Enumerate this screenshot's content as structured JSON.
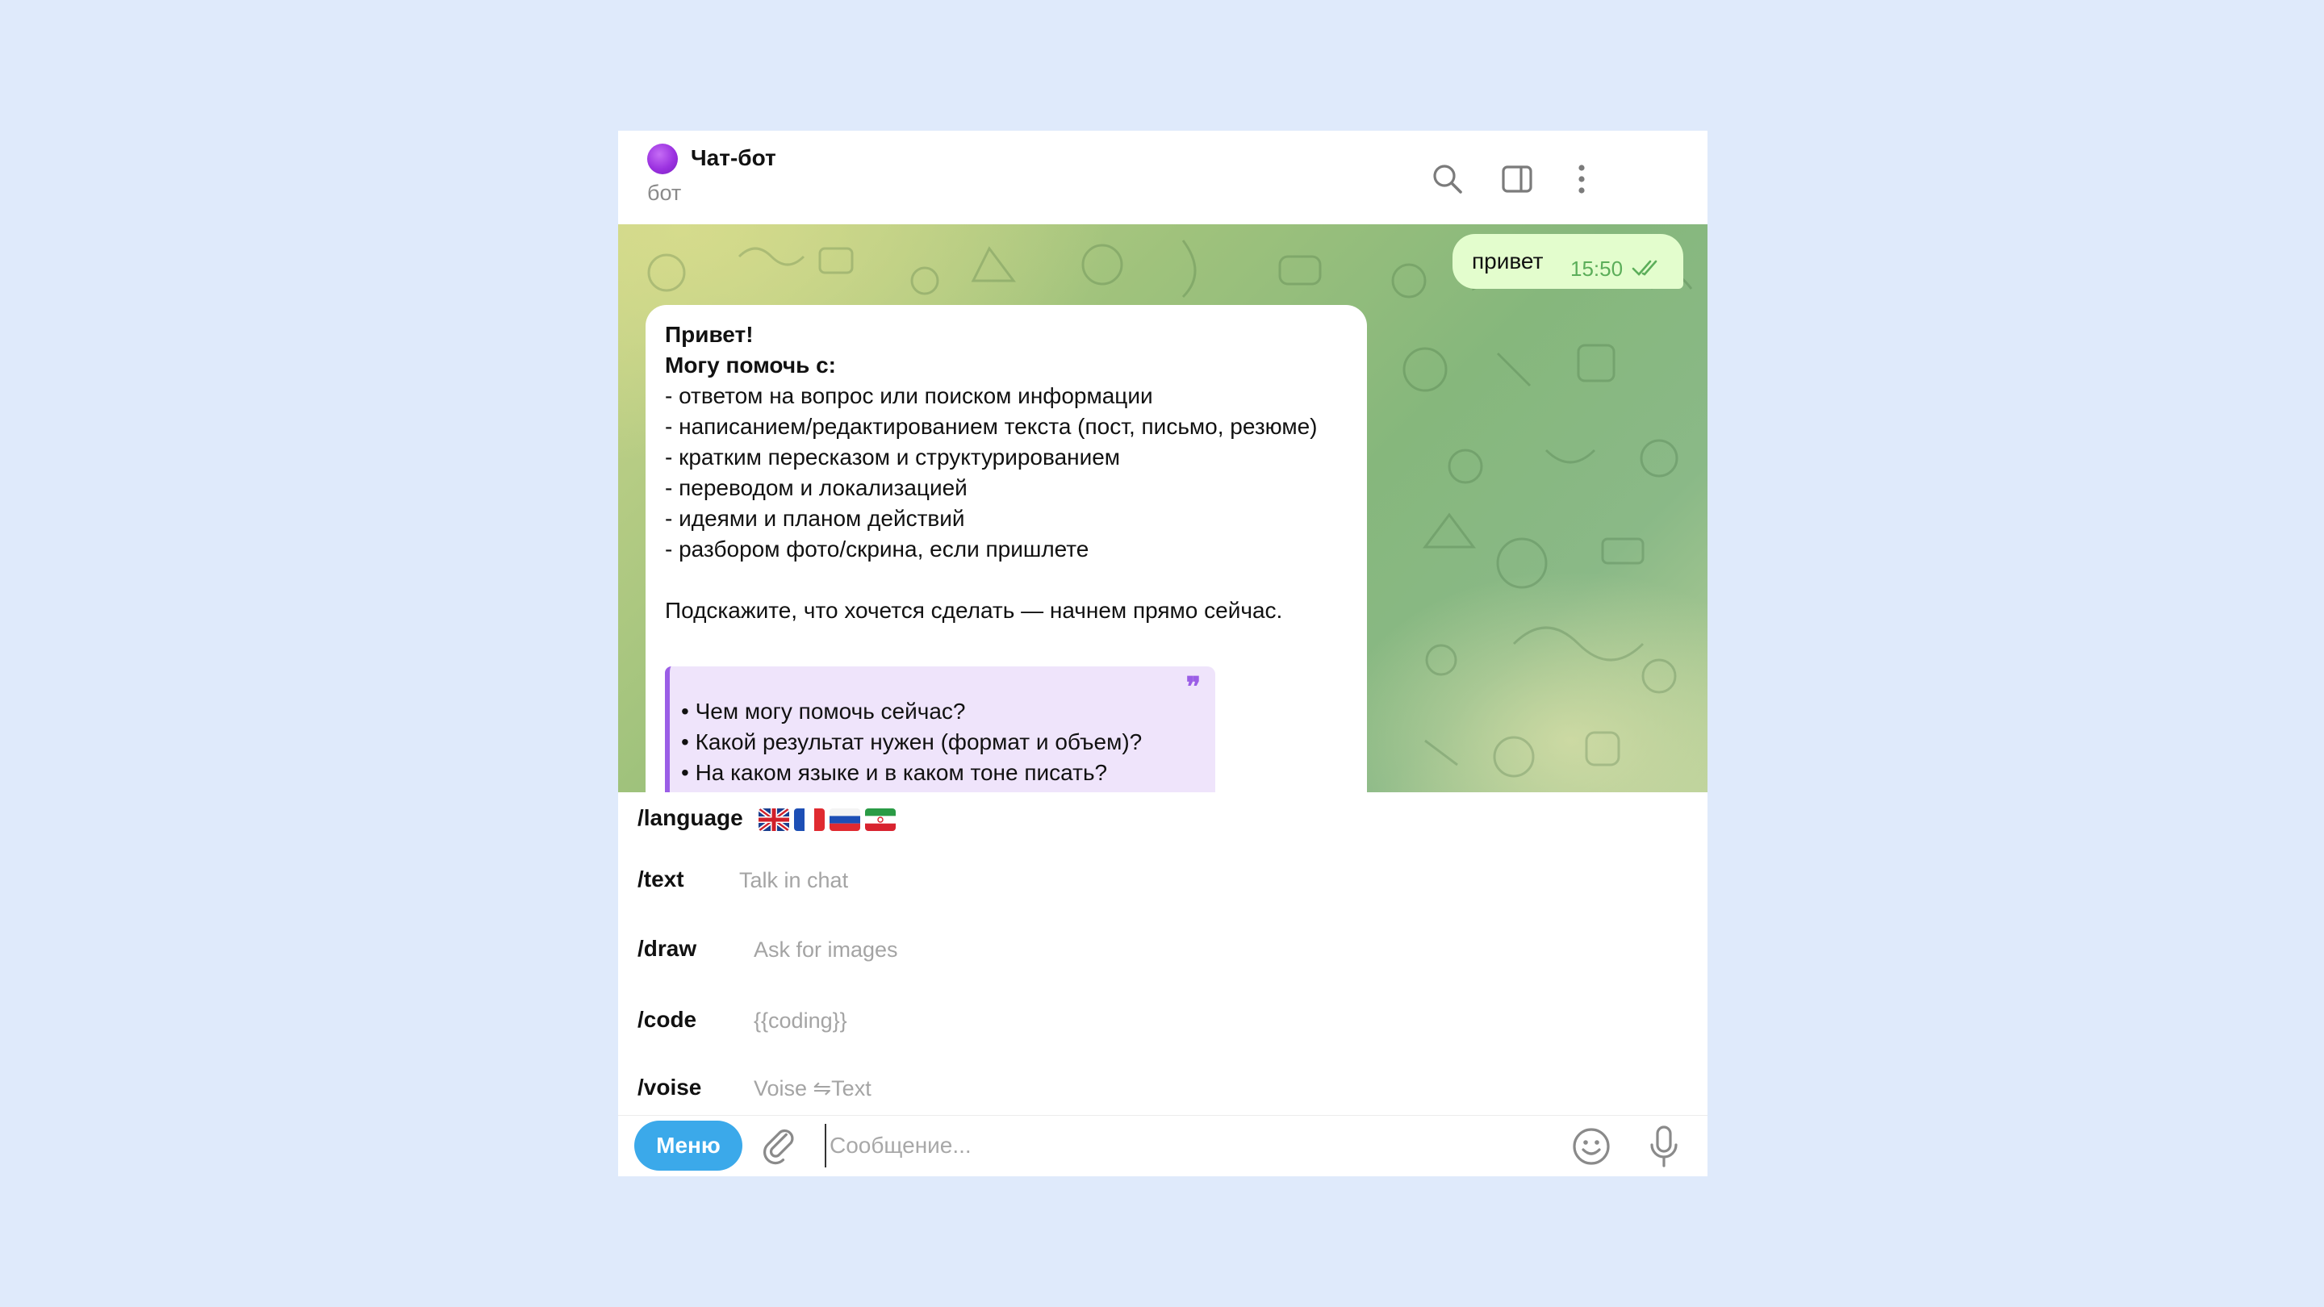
{
  "header": {
    "title": "Чат-бот",
    "status": "бот",
    "avatar_color": "#9b32e0",
    "icons": [
      "search-icon",
      "side-panel-icon",
      "more-vertical-icon"
    ]
  },
  "messages": {
    "outgoing": {
      "text": "привет",
      "time": "15:50",
      "status_icon": "double-check-icon"
    },
    "incoming": {
      "greeting": "Привет!",
      "subtitle": "Могу помочь с:",
      "items": [
        "- ответом на вопрос или поиском информации",
        "- написанием/редактированием текста (пост, письмо, резюме)",
        "- кратким пересказом и структурированием",
        "- переводом и локализацией",
        "- идеями и планом действий",
        "- разбором фото/скрина, если пришлете"
      ],
      "closing": "Подскажите, что хочется сделать — начнем прямо сейчас.",
      "quote": {
        "mark": "❞",
        "lines": [
          "• Чем могу помочь сейчас?",
          "• Какой результат нужен (формат и объем)?",
          "• На каком языке и в каком тоне писать?"
        ]
      }
    }
  },
  "commands": [
    {
      "name": "/language",
      "description": "",
      "flags": [
        "🇬🇧",
        "🇫🇷",
        "🇷🇺",
        "🇮🇷"
      ]
    },
    {
      "name": "/text",
      "description": "Talk in chat"
    },
    {
      "name": "/draw",
      "description": "Ask for images"
    },
    {
      "name": "/code",
      "description": "{{coding}}"
    },
    {
      "name": "/voise",
      "description": "Voise ⇋Text"
    }
  ],
  "composer": {
    "menu_label": "Меню",
    "placeholder": "Сообщение...",
    "icons": [
      "paperclip-icon",
      "emoji-icon",
      "microphone-icon"
    ]
  },
  "colors": {
    "page_bg": "#dfeafb",
    "accent": "#3ba9ea",
    "outgoing_bubble": "#e3fdcd",
    "quote_bg": "#efe4fb",
    "quote_bar": "#9b5ee6"
  }
}
